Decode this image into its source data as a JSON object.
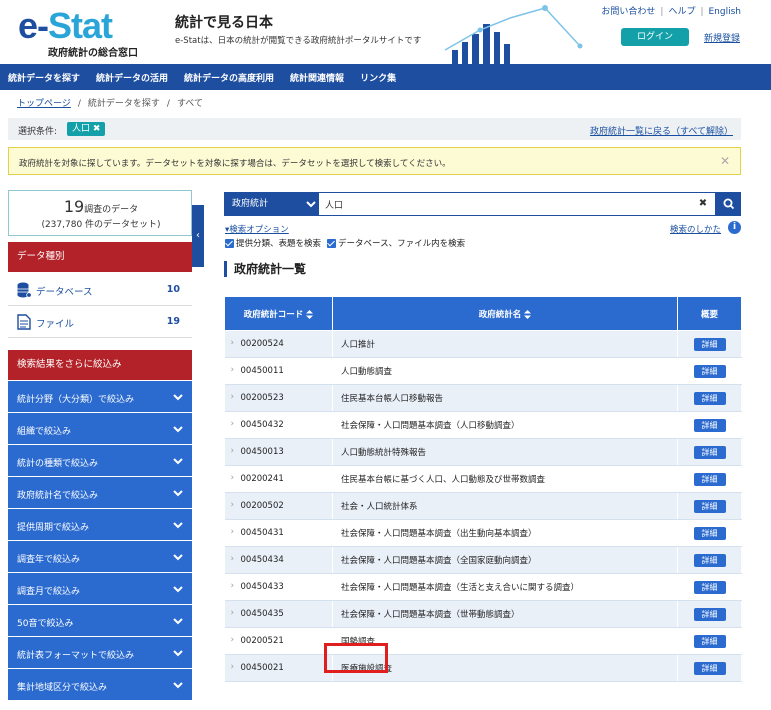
{
  "header": {
    "logo_main": "e-",
    "logo_accent": "Stat",
    "logo_sub": "政府統計の総合窓口",
    "title": "統計で見る日本",
    "description": "e-Statは、日本の統計が閲覧できる政府統計ポータルサイトです",
    "top_links": [
      "お問い合わせ",
      "ヘルプ",
      "English"
    ],
    "login_label": "ログイン",
    "register_label": "新規登録"
  },
  "nav": {
    "items": [
      "統計データを探す",
      "統計データの活用",
      "統計データの高度利用",
      "統計関連情報",
      "リンク集"
    ]
  },
  "breadcrumb": {
    "top": "トップページ",
    "middle": "統計データを探す",
    "current": "すべて"
  },
  "condition": {
    "label": "選択条件:",
    "chip": "人口 ✖",
    "clear_link": "政府統計一覧に戻る（すべて解除）"
  },
  "notice": {
    "text": "政府統計を対象に探しています。データセットを対象に探す場合は、データセットを選択して検索してください。",
    "close": "✕"
  },
  "sidebar": {
    "count_number": "19",
    "count_unit": "調査のデータ",
    "count_sub": "(237,780 件のデータセット)",
    "data_type_header": "データ種別",
    "types": [
      {
        "label": "データベース",
        "count": "10",
        "icon": "database-icon"
      },
      {
        "label": "ファイル",
        "count": "19",
        "icon": "file-icon"
      }
    ],
    "refine_header": "検索結果をさらに絞込み",
    "filters": [
      "統計分野（大分類）で絞込み",
      "組織で絞込み",
      "統計の種類で絞込み",
      "政府統計名で絞込み",
      "提供周期で絞込み",
      "調査年で絞込み",
      "調査月で絞込み",
      "50音で絞込み",
      "統計表フォーマットで絞込み",
      "集計地域区分で絞込み"
    ]
  },
  "search": {
    "scope": "政府統計",
    "query": "人口",
    "clear": "✖",
    "options_link": "▾検索オプション",
    "help_link": "検索のしかた",
    "check1": "提供分類、表題を検索",
    "check2": "データベース、ファイル内を検索"
  },
  "section_title": "政府統計一覧",
  "table": {
    "headers": {
      "code": "政府統計コード",
      "name": "政府統計名",
      "summary": "概要"
    },
    "detail_label": "詳細",
    "rows": [
      {
        "code": "00200524",
        "name": "人口推計"
      },
      {
        "code": "00450011",
        "name": "人口動態調査"
      },
      {
        "code": "00200523",
        "name": "住民基本台帳人口移動報告"
      },
      {
        "code": "00450432",
        "name": "社会保障・人口問題基本調査（人口移動調査）"
      },
      {
        "code": "00450013",
        "name": "人口動態統計特殊報告"
      },
      {
        "code": "00200241",
        "name": "住民基本台帳に基づく人口、人口動態及び世帯数調査"
      },
      {
        "code": "00200502",
        "name": "社会・人口統計体系"
      },
      {
        "code": "00450431",
        "name": "社会保障・人口問題基本調査（出生動向基本調査）"
      },
      {
        "code": "00450434",
        "name": "社会保障・人口問題基本調査（全国家庭動向調査）"
      },
      {
        "code": "00450433",
        "name": "社会保障・人口問題基本調査（生活と支え合いに関する調査）"
      },
      {
        "code": "00450435",
        "name": "社会保障・人口問題基本調査（世帯動態調査）"
      },
      {
        "code": "00200521",
        "name": "国勢調査"
      },
      {
        "code": "00450021",
        "name": "医療施設調査"
      }
    ]
  },
  "colors": {
    "brand": "#1d4ea0",
    "accent_teal": "#14a0a8",
    "sidebar_red": "#b22228",
    "filter_blue": "#2b6bd0",
    "highlight": "#e01e1e"
  }
}
